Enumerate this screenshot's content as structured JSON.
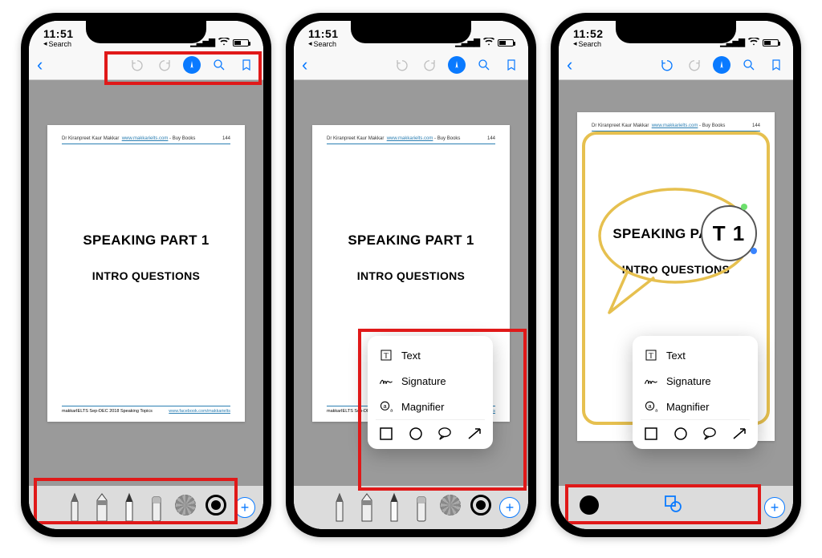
{
  "status": {
    "time_a": "11:51",
    "time_b": "11:51",
    "time_c": "11:52",
    "back_label": "Search",
    "signal_glyph": "▁▃▅▇",
    "wifi_glyph": "􀙇"
  },
  "nav": {
    "undo_name": "undo",
    "redo_name": "redo",
    "markup_name": "markup",
    "search_name": "search",
    "bookmark_name": "bookmark"
  },
  "doc": {
    "head_author": "Dr Kiranpreet Kaur Makkar",
    "head_url": "www.makkarielts.com",
    "head_buy": " - Buy Books",
    "head_page": "144",
    "title1": "SPEAKING PART 1",
    "title2": "INTRO QUESTIONS",
    "foot_left": "makkarIELTS Sep-DEC 2018 Speaking Topics",
    "foot_right": "www.facebook.com/makkarielts",
    "mag_text": "T 1"
  },
  "tools": {
    "pen": "pen",
    "marker": "marker",
    "pencil": "pencil",
    "eraser": "eraser",
    "lasso": "lasso",
    "color": "color",
    "plus_glyph": "+"
  },
  "popup": {
    "text": "Text",
    "signature": "Signature",
    "magnifier": "Magnifier"
  }
}
